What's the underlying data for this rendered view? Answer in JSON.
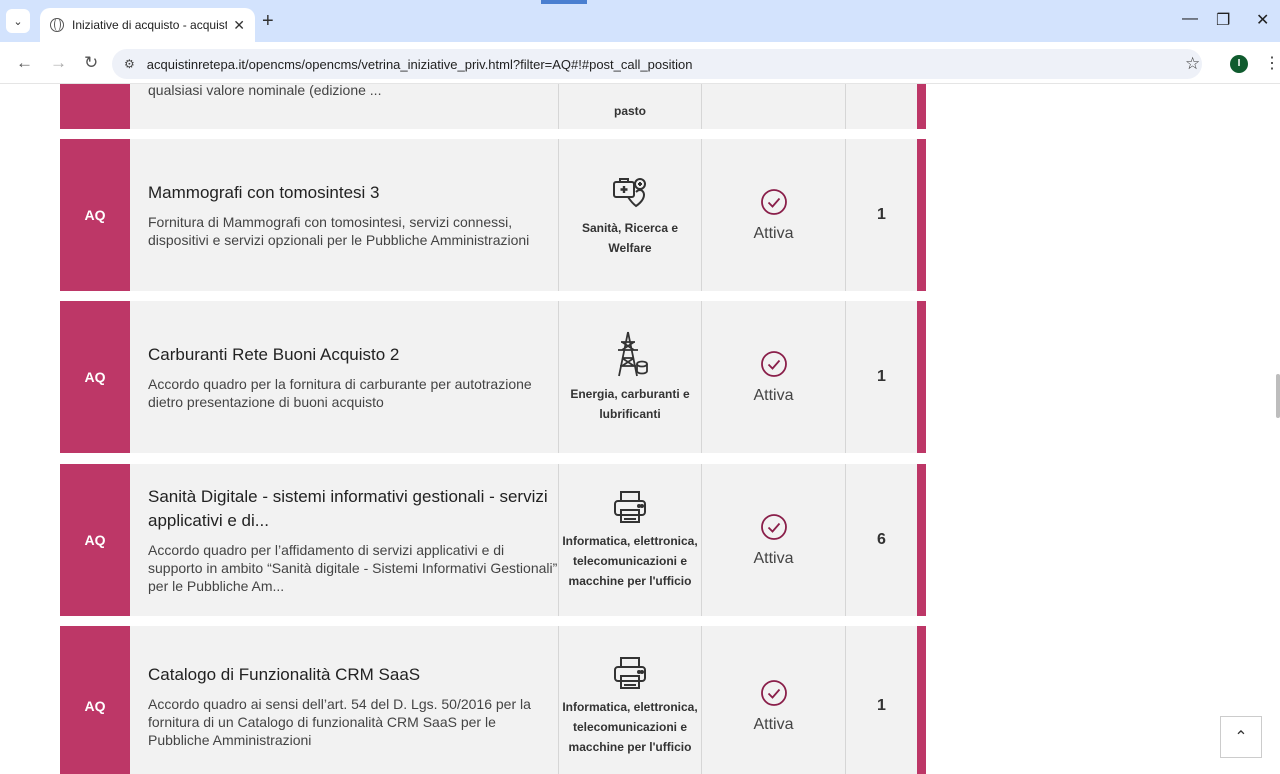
{
  "browser": {
    "tab_title": "Iniziative di acquisto - acquistin",
    "tab_close": "✕",
    "new_tab": "+",
    "url": "acquistinretepa.it/opencms/opencms/vetrina_iniziative_priv.html?filter=AQ#!#post_call_position",
    "profile_initial": "I"
  },
  "partial_card": {
    "desc": "qualsiasi valore nominale (edizione ...",
    "category": "pasto"
  },
  "cards": [
    {
      "badge": "AQ",
      "title": "Mammografi con tomosintesi 3",
      "desc": "Fornitura di Mammografi con tomosintesi, servizi connessi, dispositivi e servizi opzionali per le Pubbliche Amministrazioni",
      "category": "Sanità, Ricerca e Welfare",
      "category_icon": "health-icon",
      "status": "Attiva",
      "count": "1"
    },
    {
      "badge": "AQ",
      "title": "Carburanti Rete Buoni Acquisto 2",
      "desc": "Accordo quadro per la fornitura di carburante per autotrazione dietro presentazione di buoni acquisto",
      "category": "Energia, carburanti e lubrificanti",
      "category_icon": "energy-tower-icon",
      "status": "Attiva",
      "count": "1"
    },
    {
      "badge": "AQ",
      "title": "Sanità Digitale - sistemi informativi gestionali - servizi applicativi e di...",
      "desc": "Accordo quadro per l’affidamento di servizi applicativi e di supporto in ambito “Sanità digitale - Sistemi Informativi Gestionali” per le Pubbliche Am...",
      "category": "Informatica, elettronica, telecomunicazioni e macchine per l'ufficio",
      "category_icon": "printer-icon",
      "status": "Attiva",
      "count": "6"
    },
    {
      "badge": "AQ",
      "title": "Catalogo di Funzionalità CRM SaaS",
      "desc": "Accordo quadro ai sensi dell’art. 54 del D. Lgs. 50/2016 per la fornitura di un Catalogo di funzionalità CRM SaaS per le Pubbliche Amministrazioni",
      "category": "Informatica, elettronica, telecomunicazioni e macchine per l'ufficio",
      "category_icon": "printer-icon",
      "status": "Attiva",
      "count": "1"
    }
  ],
  "colors": {
    "accent": "#bd3767",
    "card_bg": "#f2f2f2",
    "status_icon": "#8a1f4a"
  }
}
